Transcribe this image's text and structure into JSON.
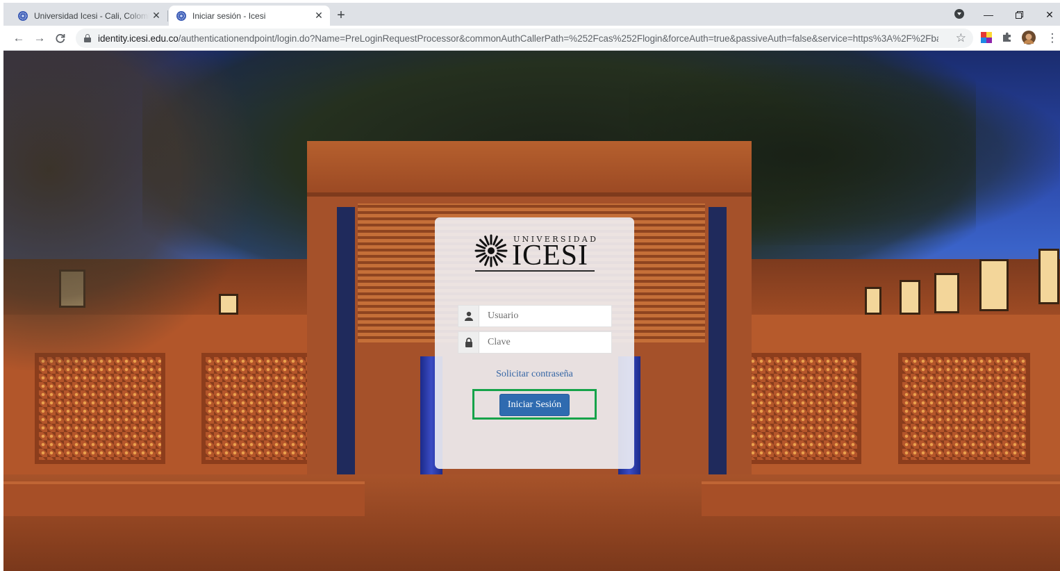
{
  "browser": {
    "tabs": [
      {
        "title": "Universidad Icesi - Cali, Colombia",
        "active": false
      },
      {
        "title": "Iniciar sesión - Icesi",
        "active": true
      }
    ],
    "url_host": "identity.icesi.edu.co",
    "url_rest": "/authenticationendpoint/login.do?Name=PreLoginRequestProcessor&commonAuthCallerPath=%252Fcas%252Flogin&forceAuth=true&passiveAuth=false&service=https%3A%2F%2Fba...",
    "icons": {
      "close_tab": "close-icon",
      "new_tab": "plus-icon",
      "back": "arrow-left-icon",
      "forward": "arrow-right-icon",
      "reload": "reload-icon",
      "secure": "lock-icon",
      "bookmark": "star-icon",
      "extensions": "puzzle-icon",
      "menu": "kebab-menu-icon",
      "minimize": "minimize-icon",
      "restore": "restore-icon",
      "close_window": "close-icon"
    }
  },
  "login": {
    "logo_over": "UNIVERSIDAD",
    "logo_main": "ICESI",
    "username_placeholder": "Usuario",
    "password_placeholder": "Clave",
    "forgot_password": "Solicitar contraseña",
    "submit_label": "Iniciar Sesión",
    "highlight_color": "#16a34a",
    "button_color": "#2f6bb0",
    "link_color": "#3465a4"
  }
}
